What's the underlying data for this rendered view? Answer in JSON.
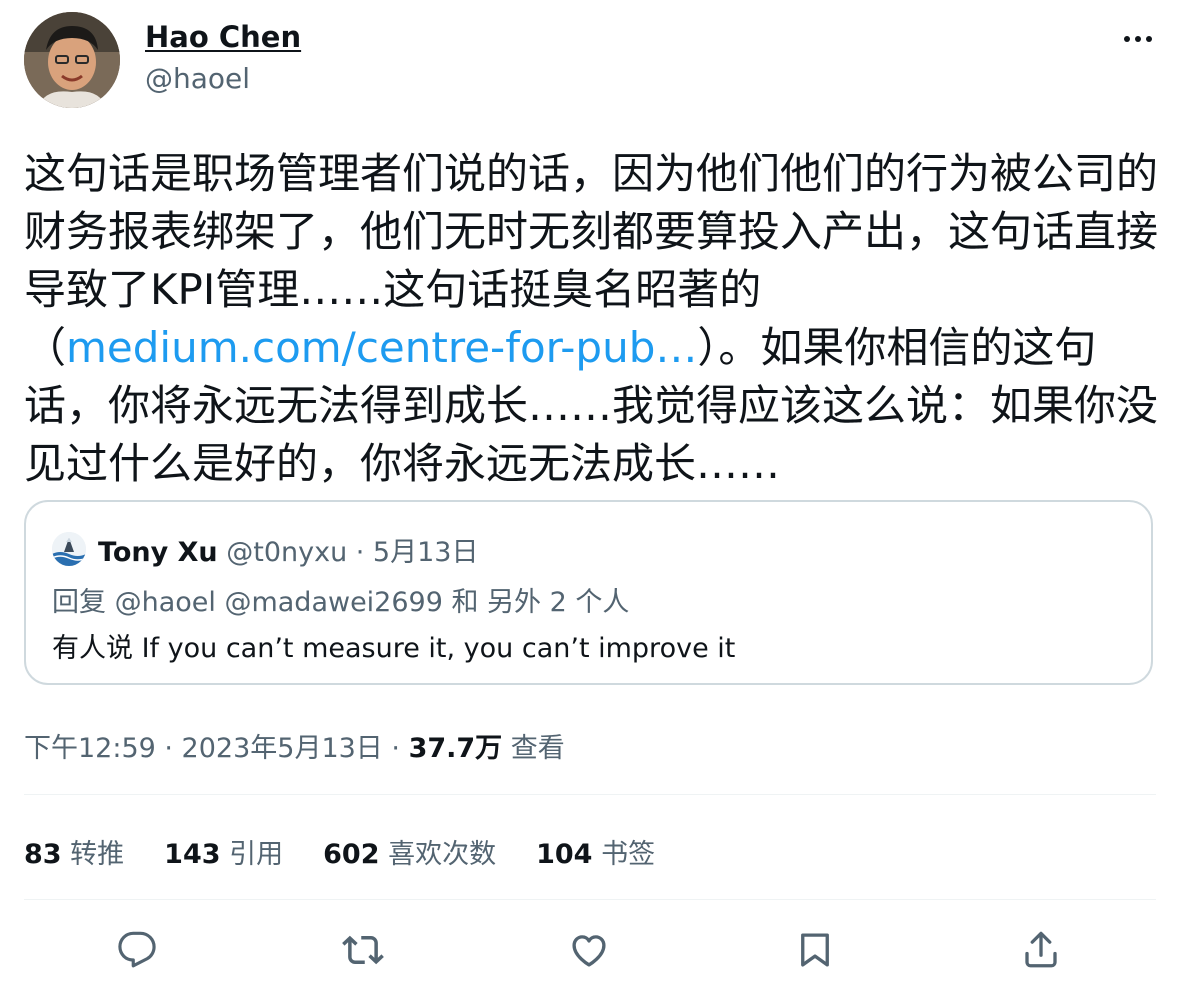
{
  "author": {
    "name": "Hao Chen",
    "handle": "@haoel",
    "more_icon": "more-horizontal-icon"
  },
  "tweet": {
    "text_before_link": "这句话是职场管理者们说的话，因为他们他们的行为被公司的财务报表绑架了，他们无时无刻都要算投入产出，这句话直接导致了KPI管理……这句话挺臭名昭著的（",
    "link_text": "medium.com/centre-for-pub…",
    "text_after_link": "）。如果你相信的这句话，你将永远无法得到成长……我觉得应该这么说：如果你没见过什么是好的，你将永远无法成长……",
    "link_color": "#1d9bf0"
  },
  "quote": {
    "name": "Tony Xu",
    "handle_date": " @t0nyxu · 5月13日",
    "reply_line": "回复 @haoel @madawei2699 和 另外 2 个人",
    "text": "有人说 If you can’t measure it, you can’t improve it"
  },
  "meta": {
    "time_date": "下午12:59 · 2023年5月13日 · ",
    "views_num": "37.7万",
    "views_label": " 查看"
  },
  "stats": [
    {
      "num": "83",
      "label": " 转推"
    },
    {
      "num": "143",
      "label": " 引用"
    },
    {
      "num": "602",
      "label": " 喜欢次数"
    },
    {
      "num": "104",
      "label": " 书签"
    }
  ],
  "actions": [
    "reply-icon",
    "retweet-icon",
    "like-icon",
    "bookmark-icon",
    "share-icon"
  ],
  "colors": {
    "text": "#0f1419",
    "secondary": "#536471",
    "border": "#cfd9de",
    "accent": "#1d9bf0"
  }
}
